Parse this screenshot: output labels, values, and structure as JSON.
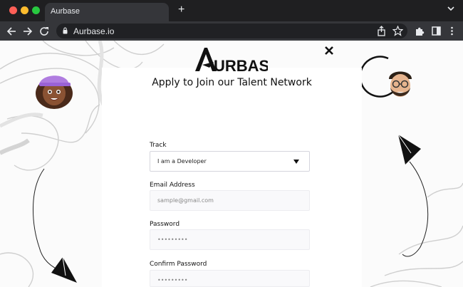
{
  "browser": {
    "tab_title": "Aurbase",
    "new_tab_symbol": "+",
    "url": "Aurbase.io",
    "colors": {
      "frame": "#1f1f21",
      "toolbar": "#35363a",
      "omnibox": "#202124"
    },
    "icons": [
      "back-arrow-icon",
      "forward-arrow-icon",
      "reload-icon",
      "lock-icon",
      "share-icon",
      "bookmark-star-icon",
      "extensions-icon",
      "sidebar-icon",
      "kebab-menu-icon",
      "tab-menu-chevron-icon"
    ]
  },
  "modal": {
    "logo_text": "URBASE",
    "heading": "Apply to Join our Talent Network",
    "close_icon": "close-icon",
    "fields": [
      {
        "label": "Track",
        "value": "I am a Developer",
        "type": "select"
      },
      {
        "label": "Email Address",
        "placeholder": "sample@gmail.com",
        "type": "email"
      },
      {
        "label": "Password",
        "placeholder": "•••••••••",
        "type": "password"
      },
      {
        "label": "Confirm Password",
        "placeholder": "•••••••••",
        "type": "password"
      }
    ]
  }
}
